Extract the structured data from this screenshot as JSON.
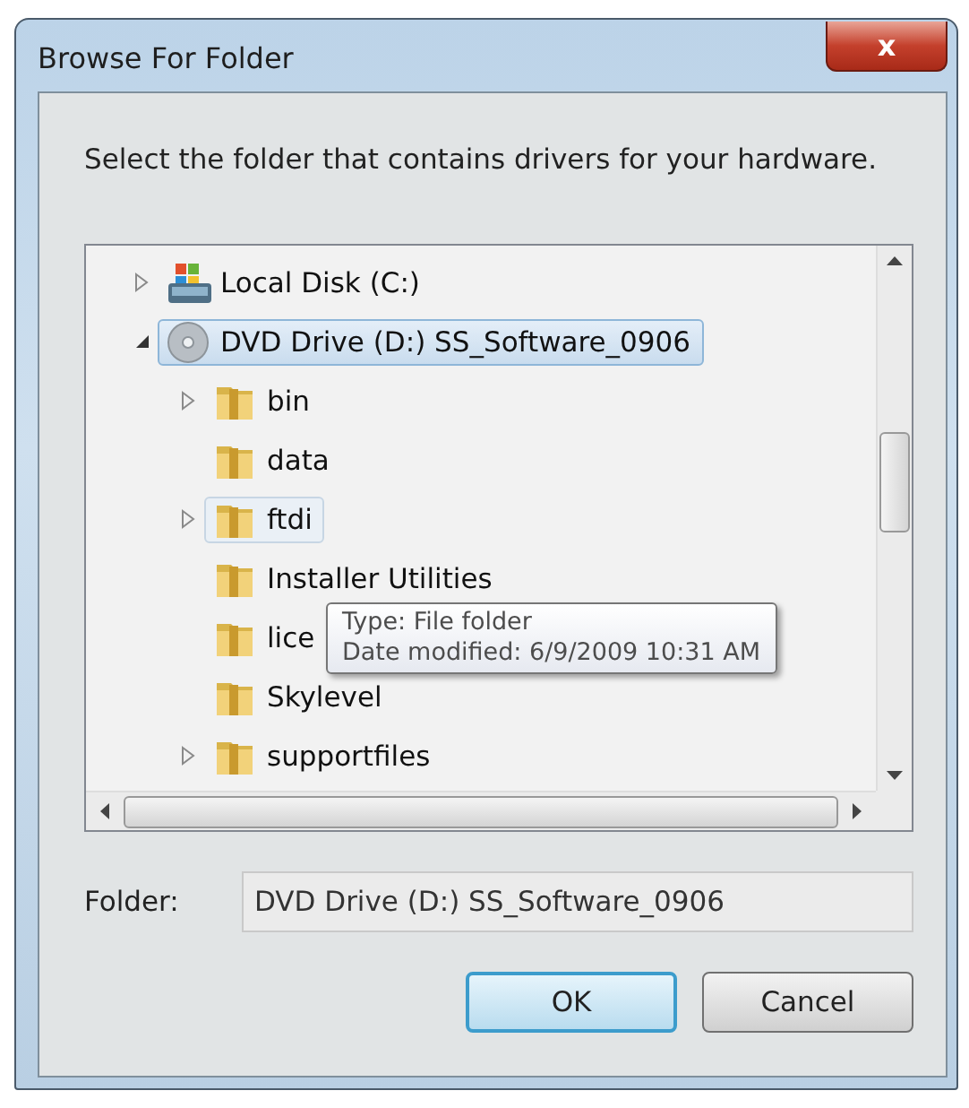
{
  "window": {
    "title": "Browse For Folder",
    "close_label": "x"
  },
  "instruction": "Select the folder that contains drivers for your hardware.",
  "tree": {
    "items": [
      {
        "label": "Local Disk (C:)",
        "kind": "disk",
        "has_children": true,
        "expanded": false,
        "selected": false,
        "hovered": false
      },
      {
        "label": "DVD Drive (D:) SS_Software_0906",
        "kind": "dvd",
        "has_children": true,
        "expanded": true,
        "selected": true,
        "hovered": false,
        "children": [
          {
            "label": "bin",
            "kind": "folder",
            "has_children": true,
            "expanded": false,
            "selected": false,
            "hovered": false
          },
          {
            "label": "data",
            "kind": "folder",
            "has_children": false,
            "selected": false,
            "hovered": false
          },
          {
            "label": "ftdi",
            "kind": "folder",
            "has_children": true,
            "expanded": false,
            "selected": false,
            "hovered": true
          },
          {
            "label": "Installer Utilities",
            "kind": "folder",
            "has_children": false,
            "selected": false,
            "hovered": false
          },
          {
            "label": "lice",
            "kind": "folder",
            "has_children": false,
            "selected": false,
            "hovered": false
          },
          {
            "label": "Skylevel",
            "kind": "folder",
            "has_children": false,
            "selected": false,
            "hovered": false
          },
          {
            "label": "supportfiles",
            "kind": "folder",
            "has_children": true,
            "expanded": false,
            "selected": false,
            "hovered": false
          }
        ]
      }
    ]
  },
  "tooltip": {
    "lines": [
      "Type: File folder",
      "Date modified: 6/9/2009 10:31 AM"
    ]
  },
  "folder_field": {
    "label": "Folder:",
    "value": "DVD Drive (D:) SS_Software_0906"
  },
  "buttons": [
    {
      "label": "OK",
      "default": true
    },
    {
      "label": "Cancel",
      "default": false
    }
  ]
}
